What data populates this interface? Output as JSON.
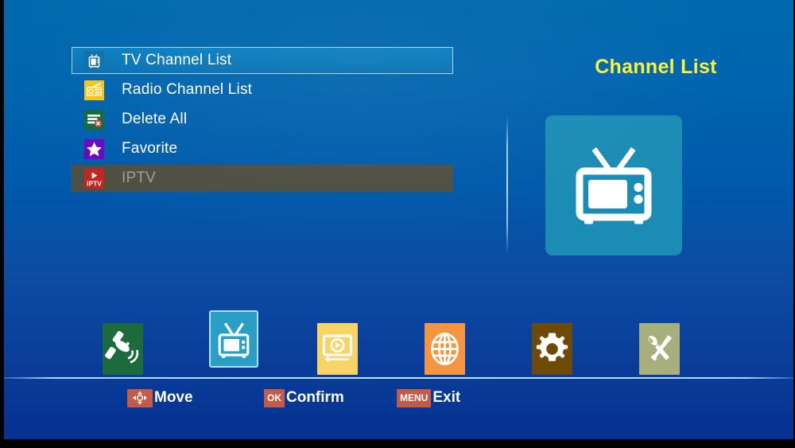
{
  "screen": {
    "background_top_color": "#0069ad",
    "background_bottom_color": "#063192"
  },
  "menu": {
    "items": [
      {
        "label": "TV Channel List",
        "icon": "tv-icon",
        "state": "selected",
        "icon_bg": "#0e6fa8"
      },
      {
        "label": "Radio Channel List",
        "icon": "radio-icon",
        "state": "normal",
        "icon_bg": "#f5c518"
      },
      {
        "label": "Delete All",
        "icon": "delete-list-icon",
        "state": "normal",
        "icon_bg": "#16693a"
      },
      {
        "label": "Favorite",
        "icon": "star-icon",
        "state": "normal",
        "icon_bg": "#6a06c4"
      },
      {
        "label": "IPTV",
        "icon": "iptv-icon",
        "state": "disabled",
        "icon_bg": "#c3241f"
      }
    ]
  },
  "panel": {
    "title": "Channel List",
    "title_color": "#fbf23a",
    "tile_color": "#1b8cb5",
    "tile_icon": "tv-set-icon"
  },
  "toolbar": {
    "items": [
      {
        "name": "installation",
        "icon": "satellite-dish-icon",
        "color": "#1d6b3c",
        "selected": false
      },
      {
        "name": "channel",
        "icon": "tv-icon",
        "color": "#2a9ec4",
        "selected": true
      },
      {
        "name": "media",
        "icon": "media-player-icon",
        "color": "#f7d464",
        "selected": false
      },
      {
        "name": "network",
        "icon": "globe-icon",
        "color": "#f59540",
        "selected": false
      },
      {
        "name": "settings",
        "icon": "gear-icon",
        "color": "#6d4b06",
        "selected": false
      },
      {
        "name": "tools",
        "icon": "wrench-screwdriver-icon",
        "color": "#a8ae7c",
        "selected": false
      }
    ]
  },
  "hints": [
    {
      "key": "dpad-icon",
      "label": "Move",
      "key_color": "#c25c4a"
    },
    {
      "key": "OK",
      "label": "Confirm",
      "key_color": "#c25c4a"
    },
    {
      "key": "MENU",
      "label": "Exit",
      "key_color": "#c25c4a"
    }
  ]
}
